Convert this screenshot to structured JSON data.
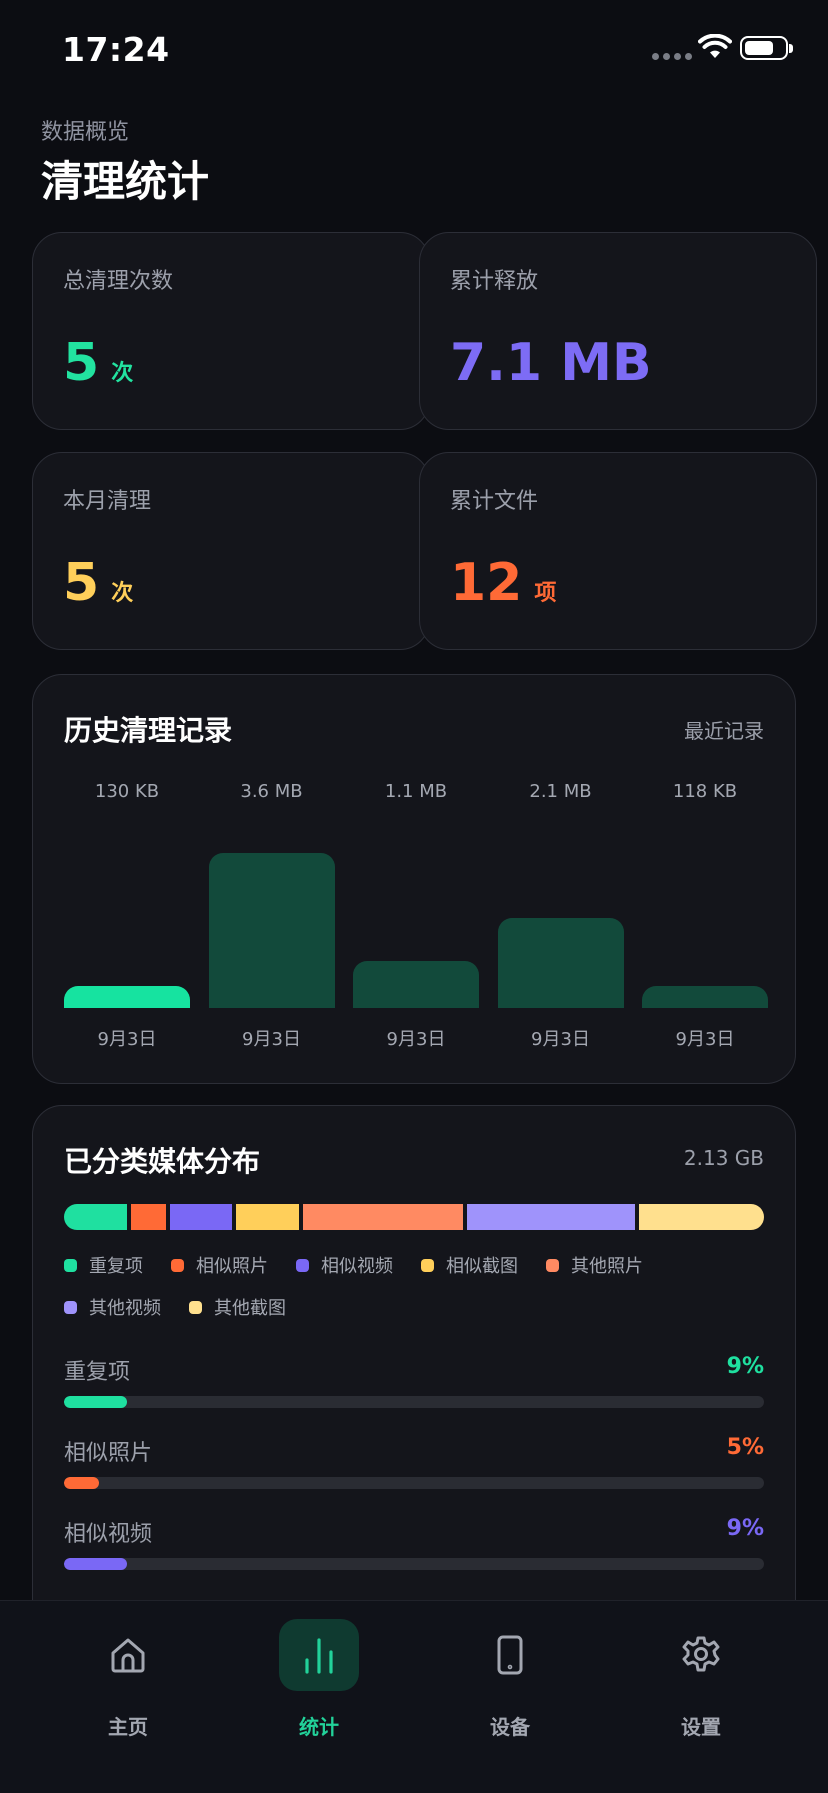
{
  "status": {
    "time": "17:24"
  },
  "header": {
    "subtitle": "数据概览",
    "title": "清理统计"
  },
  "stats": [
    {
      "label": "总清理次数",
      "value": "5",
      "unit": "次",
      "color": "#22e3a0"
    },
    {
      "label": "累计释放",
      "value": "7.1 MB",
      "unit": "",
      "color": "#7d6cf5"
    },
    {
      "label": "本月清理",
      "value": "5",
      "unit": "次",
      "color": "#ffcf5a"
    },
    {
      "label": "累计文件",
      "value": "12",
      "unit": "项",
      "color": "#ff6a36"
    }
  ],
  "history": {
    "title": "历史清理记录",
    "right_label": "最近记录",
    "chart_data": {
      "type": "bar",
      "categories": [
        "9月3日",
        "9月3日",
        "9月3日",
        "9月3日",
        "9月3日"
      ],
      "value_labels": [
        "130 KB",
        "3.6 MB",
        "1.1 MB",
        "2.1 MB",
        "118 KB"
      ],
      "values_mb": [
        0.13,
        3.6,
        1.1,
        2.1,
        0.118
      ],
      "highlight_index": 0,
      "colors": {
        "highlight": "#16e3a0",
        "default": "#124a3b"
      }
    }
  },
  "media": {
    "title": "已分类媒体分布",
    "total": "2.13 GB",
    "categories": [
      {
        "label": "重复项",
        "color": "#1fe0a0",
        "share": 9
      },
      {
        "label": "相似照片",
        "color": "#ff6a36",
        "share": 5
      },
      {
        "label": "相似视频",
        "color": "#7a68f5",
        "share": 9
      },
      {
        "label": "相似截图",
        "color": "#ffcf5a",
        "share": 9
      },
      {
        "label": "其他照片",
        "color": "#ff8a62",
        "share": 23
      },
      {
        "label": "其他视频",
        "color": "#9f93fb",
        "share": 24
      },
      {
        "label": "其他截图",
        "color": "#ffe08e",
        "share": 18
      }
    ],
    "progress": [
      {
        "label": "重复项",
        "percent": "9%",
        "value": 9,
        "color": "#1fe0a0"
      },
      {
        "label": "相似照片",
        "percent": "5%",
        "value": 5,
        "color": "#ff6a36"
      },
      {
        "label": "相似视频",
        "percent": "9%",
        "value": 9,
        "color": "#7a68f5"
      }
    ]
  },
  "nav": {
    "active": 1,
    "items": [
      {
        "label": "主页",
        "icon": "home-icon"
      },
      {
        "label": "统计",
        "icon": "bar-chart-icon"
      },
      {
        "label": "设备",
        "icon": "phone-icon"
      },
      {
        "label": "设置",
        "icon": "gear-icon"
      }
    ],
    "active_color": "#22d29a",
    "inactive_color": "#a3a7b1",
    "active_bg": "#0f3a30"
  }
}
